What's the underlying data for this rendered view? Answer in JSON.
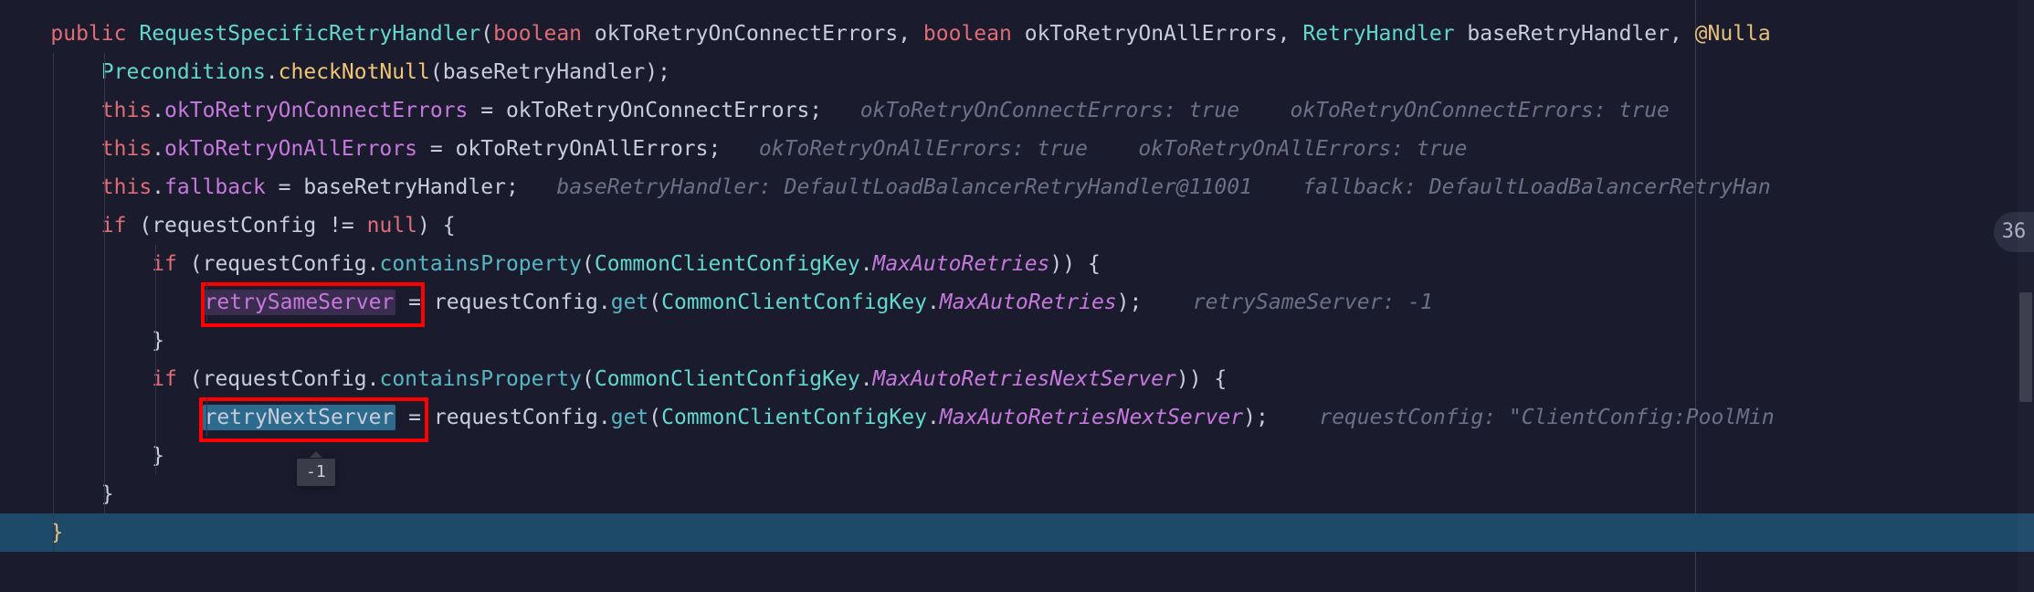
{
  "tokens": {
    "kw_public": "public",
    "kw_boolean": "boolean",
    "kw_this": "this",
    "kw_if": "if",
    "kw_null": "null",
    "kw_ne": "!=",
    "cls_handler": "RequestSpecificRetryHandler",
    "cls_retryhandler": "RetryHandler",
    "cls_preconditions": "Preconditions",
    "cls_ccck": "CommonClientConfigKey",
    "anno_nullable": "@Nulla",
    "p_okConn": "okToRetryOnConnectErrors",
    "p_okAll": "okToRetryOnAllErrors",
    "p_base": "baseRetryHandler",
    "p_reqcfg": "requestConfig",
    "f_okConn": "okToRetryOnConnectErrors",
    "f_okAll": "okToRetryOnAllErrors",
    "f_fallback": "fallback",
    "m_checkNotNull": "checkNotNull",
    "m_containsProperty": "containsProperty",
    "m_get": "get",
    "sf_maxAuto": "MaxAutoRetries",
    "sf_maxAutoNext": "MaxAutoRetriesNextServer",
    "hl_retrySame": "retrySameServer",
    "hl_retryNext": "retryNextServer"
  },
  "hints": {
    "l3": "okToRetryOnConnectErrors: true    okToRetryOnConnectErrors: true",
    "l4": "okToRetryOnAllErrors: true    okToRetryOnAllErrors: true",
    "l5": "baseRetryHandler: DefaultLoadBalancerRetryHandler@11001    fallback: DefaultLoadBalancerRetryHan",
    "l7": " retrySameServer: -1",
    "l9": " requestConfig: \"ClientConfig:PoolMin"
  },
  "tooltip": "-1",
  "side_badge": "36",
  "colors": {
    "bg": "#1a1c2e",
    "keyword": "#e06c75",
    "type": "#56b6c2",
    "class": "#61d7cf",
    "field": "#c678dd",
    "hint": "#6b7089",
    "highlight_red": "#ff0000"
  }
}
